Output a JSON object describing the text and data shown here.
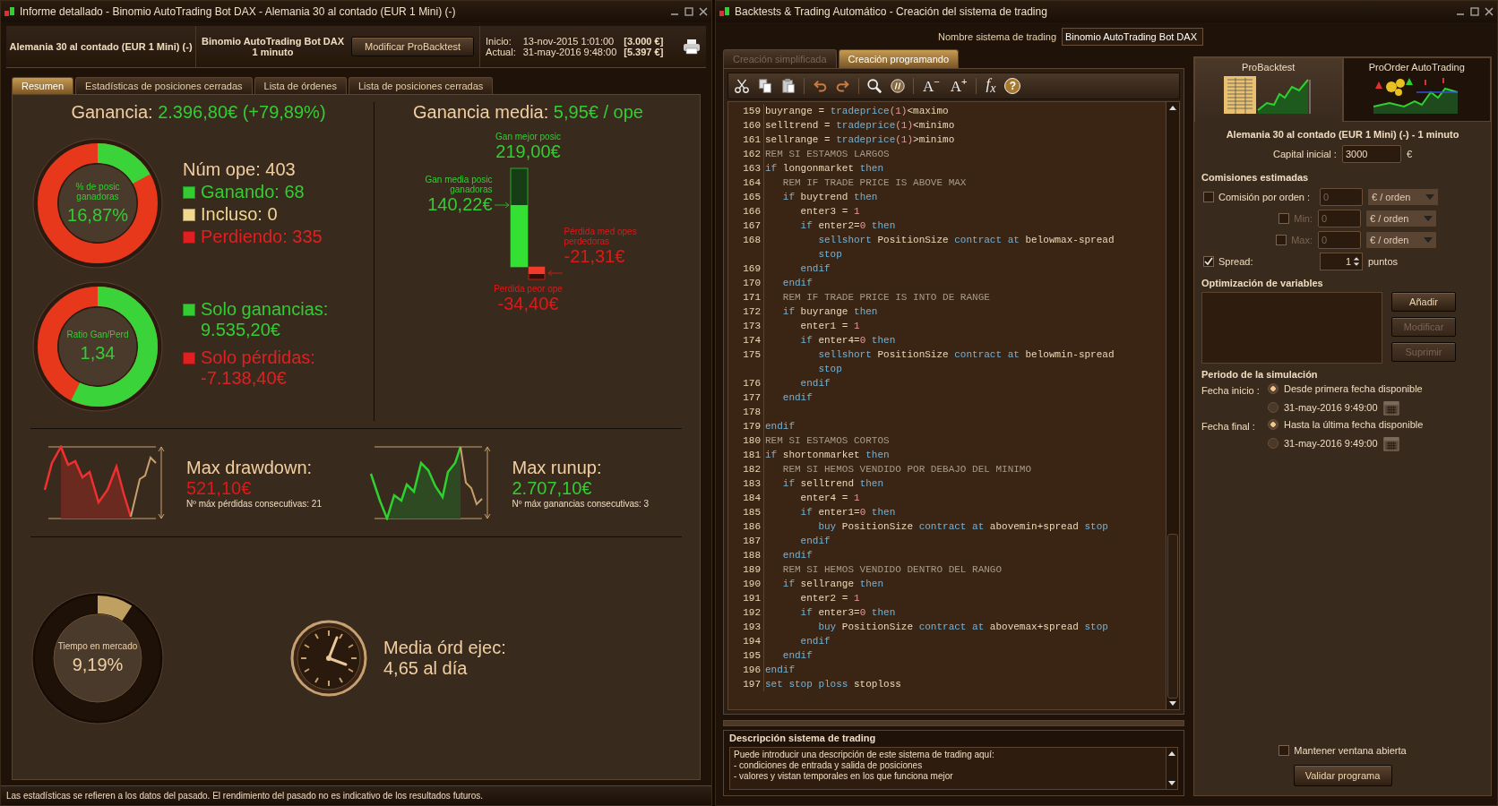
{
  "left_window": {
    "title": "Informe detallado - Binomio AutoTrading Bot DAX - Alemania 30 al contado (EUR 1 Mini) (-)",
    "header": {
      "instrument": "Alemania 30 al contado (EUR 1 Mini) (-)",
      "system_name": "Binomio AutoTrading Bot DAX",
      "timeframe": "1 minuto",
      "modify_button": "Modificar ProBacktest",
      "dates": [
        {
          "label": "Inicio:",
          "value": "13-nov-2015 1:01:00",
          "capital": "[3.000 €]"
        },
        {
          "label": "Actual:",
          "value": "31-may-2016 9:48:00",
          "capital": "[5.397 €]"
        }
      ]
    },
    "tabs": [
      {
        "label": "Resumen",
        "selected": true
      },
      {
        "label": "Estadísticas de posiciones cerradas",
        "selected": false
      },
      {
        "label": "Lista de órdenes",
        "selected": false
      },
      {
        "label": "Lista de posiciones cerradas",
        "selected": false
      }
    ],
    "summary": {
      "gain": {
        "label": "Ganancia:",
        "value": "2.396,80€ (+79,89%)"
      },
      "win_donut": {
        "label": "% de posic ganadoras",
        "value": "16,87%",
        "level": 0.1687
      },
      "num_ope": "Núm ope: 403",
      "counts": [
        {
          "text": "Ganando: 68",
          "color": "#33cc33"
        },
        {
          "text": "Incluso: 0",
          "color": "#f0d890"
        },
        {
          "text": "Perdiendo: 335",
          "color": "#e02020"
        }
      ],
      "ratio_donut": {
        "label": "Ratio Gan/Perd",
        "value": "1,34",
        "level": 0.572
      },
      "totals": [
        {
          "label": "Solo ganancias:",
          "value": "9.535,20€",
          "color": "#33cc33"
        },
        {
          "label": "Solo pérdidas:",
          "value": "-7.138,40€",
          "color": "#e02020"
        }
      ],
      "avg_gain": {
        "label": "Ganancia media:",
        "value": "5,95€ / ope"
      },
      "best": {
        "label": "Gan mejor posic",
        "value": "219,00€"
      },
      "avg_win": {
        "label": "Gan media posic ganadoras",
        "value": "140,22€"
      },
      "avg_loss": {
        "label": "Pérdida med opes perdedoras",
        "value": "-21,31€"
      },
      "worst": {
        "label": "Perdida peor ope",
        "value": "-34,40€"
      },
      "extremes": [
        {
          "kind": "drawdown",
          "label": "Max drawdown:",
          "value": "521,10€",
          "note": "Nº máx pérdidas consecutivas: 21"
        },
        {
          "kind": "runup",
          "label": "Max runup:",
          "value": "2.707,10€",
          "note": "Nº máx ganancias consecutivas: 3"
        }
      ],
      "market_time": {
        "label": "Tiempo en mercado",
        "value": "9,19%",
        "level": 0.0919
      },
      "orders": {
        "label": "Media órd ejec:",
        "value": "4,65 al día"
      }
    },
    "status_bar": "Las estadísticas se refieren a los datos del pasado. El rendimiento del pasado no es indicativo de los resultados futuros."
  },
  "right_window": {
    "title": "Backtests & Trading Automático - Creación del sistema de trading",
    "name_label": "Nombre sistema de trading",
    "name_value": "Binomio AutoTrading Bot DAX",
    "editor_tabs": [
      {
        "label": "Creación simplificada",
        "selected": false
      },
      {
        "label": "Creación programando",
        "selected": true
      }
    ],
    "toolbar": {
      "font_smaller": "A$^{−}$",
      "font_larger": "A$^{+}$",
      "formula": "f$_{x}$",
      "help": "?"
    },
    "code_lines": [
      {
        "n": "159",
        "parts": [
          {
            "text": "buyrange = ",
            "kind": "t"
          },
          {
            "text": "tradeprice",
            "kind": "k"
          },
          {
            "text": "(1)",
            "kind": "n"
          },
          {
            "text": "<maximo",
            "kind": "t"
          }
        ]
      },
      {
        "n": "160",
        "parts": [
          {
            "text": "selltrend = ",
            "kind": "t"
          },
          {
            "text": "tradeprice",
            "kind": "k"
          },
          {
            "text": "(1)",
            "kind": "n"
          },
          {
            "text": "<minimo",
            "kind": "t"
          }
        ]
      },
      {
        "n": "161",
        "parts": [
          {
            "text": "sellrange = ",
            "kind": "t"
          },
          {
            "text": "tradeprice",
            "kind": "k"
          },
          {
            "text": "(1)",
            "kind": "n"
          },
          {
            "text": ">minimo",
            "kind": "t"
          }
        ]
      },
      {
        "n": "162",
        "parts": [
          {
            "text": "REM SI ESTAMOS LARGOS",
            "kind": "r"
          }
        ]
      },
      {
        "n": "163",
        "parts": [
          {
            "text": "if",
            "kind": "k"
          },
          {
            "text": " longonmarket ",
            "kind": "t"
          },
          {
            "text": "then",
            "kind": "k"
          }
        ]
      },
      {
        "n": "164",
        "parts": [
          {
            "text": "   REM IF TRADE PRICE IS ABOVE MAX",
            "kind": "r"
          }
        ]
      },
      {
        "n": "165",
        "parts": [
          {
            "text": "   if",
            "kind": "k"
          },
          {
            "text": " buytrend ",
            "kind": "t"
          },
          {
            "text": "then",
            "kind": "k"
          }
        ]
      },
      {
        "n": "166",
        "parts": [
          {
            "text": "      enter3 = ",
            "kind": "t"
          },
          {
            "text": "1",
            "kind": "n"
          }
        ]
      },
      {
        "n": "167",
        "parts": [
          {
            "text": "      if",
            "kind": "k"
          },
          {
            "text": " enter2=",
            "kind": "t"
          },
          {
            "text": "0",
            "kind": "n"
          },
          {
            "text": " then",
            "kind": "k"
          }
        ]
      },
      {
        "n": "168",
        "parts": [
          {
            "text": "         sellshort",
            "kind": "k"
          },
          {
            "text": " PositionSize ",
            "kind": "t"
          },
          {
            "text": "contract at",
            "kind": "k"
          },
          {
            "text": " belowmax-spread",
            "kind": "t"
          }
        ]
      },
      {
        "parts": [
          {
            "text": "         stop",
            "kind": "k"
          }
        ]
      },
      {
        "n": "169",
        "parts": [
          {
            "text": "      endif",
            "kind": "k"
          }
        ]
      },
      {
        "n": "170",
        "parts": [
          {
            "text": "   endif",
            "kind": "k"
          }
        ]
      },
      {
        "n": "171",
        "parts": [
          {
            "text": "   REM IF TRADE PRICE IS INTO DE RANGE",
            "kind": "r"
          }
        ]
      },
      {
        "n": "172",
        "parts": [
          {
            "text": "   if",
            "kind": "k"
          },
          {
            "text": " buyrange ",
            "kind": "t"
          },
          {
            "text": "then",
            "kind": "k"
          }
        ]
      },
      {
        "n": "173",
        "parts": [
          {
            "text": "      enter1 = ",
            "kind": "t"
          },
          {
            "text": "1",
            "kind": "n"
          }
        ]
      },
      {
        "n": "174",
        "parts": [
          {
            "text": "      if",
            "kind": "k"
          },
          {
            "text": " enter4=",
            "kind": "t"
          },
          {
            "text": "0",
            "kind": "n"
          },
          {
            "text": " then",
            "kind": "k"
          }
        ]
      },
      {
        "n": "175",
        "parts": [
          {
            "text": "         sellshort",
            "kind": "k"
          },
          {
            "text": " PositionSize ",
            "kind": "t"
          },
          {
            "text": "contract at",
            "kind": "k"
          },
          {
            "text": " belowmin-spread",
            "kind": "t"
          }
        ]
      },
      {
        "parts": [
          {
            "text": "         stop",
            "kind": "k"
          }
        ]
      },
      {
        "n": "176",
        "parts": [
          {
            "text": "      endif",
            "kind": "k"
          }
        ]
      },
      {
        "n": "177",
        "parts": [
          {
            "text": "   endif",
            "kind": "k"
          }
        ]
      },
      {
        "n": "178"
      },
      {
        "n": "179",
        "parts": [
          {
            "text": "endif",
            "kind": "k"
          }
        ]
      },
      {
        "n": "180",
        "parts": [
          {
            "text": "REM SI ESTAMOS CORTOS",
            "kind": "r"
          }
        ]
      },
      {
        "n": "181",
        "parts": [
          {
            "text": "if",
            "kind": "k"
          },
          {
            "text": " shortonmarket ",
            "kind": "t"
          },
          {
            "text": "then",
            "kind": "k"
          }
        ]
      },
      {
        "n": "182",
        "parts": [
          {
            "text": "   REM SI HEMOS VENDIDO POR DEBAJO DEL MINIMO",
            "kind": "r"
          }
        ]
      },
      {
        "n": "183",
        "parts": [
          {
            "text": "   if",
            "kind": "k"
          },
          {
            "text": " selltrend ",
            "kind": "t"
          },
          {
            "text": "then",
            "kind": "k"
          }
        ]
      },
      {
        "n": "184",
        "parts": [
          {
            "text": "      enter4 = ",
            "kind": "t"
          },
          {
            "text": "1",
            "kind": "n"
          }
        ]
      },
      {
        "n": "185",
        "parts": [
          {
            "text": "      if",
            "kind": "k"
          },
          {
            "text": " enter1=",
            "kind": "t"
          },
          {
            "text": "0",
            "kind": "n"
          },
          {
            "text": " then",
            "kind": "k"
          }
        ]
      },
      {
        "n": "186",
        "parts": [
          {
            "text": "         buy",
            "kind": "k"
          },
          {
            "text": " PositionSize ",
            "kind": "t"
          },
          {
            "text": "contract at",
            "kind": "k"
          },
          {
            "text": " abovemin+spread ",
            "kind": "t"
          },
          {
            "text": "stop",
            "kind": "k"
          }
        ]
      },
      {
        "n": "187",
        "parts": [
          {
            "text": "      endif",
            "kind": "k"
          }
        ]
      },
      {
        "n": "188",
        "parts": [
          {
            "text": "   endif",
            "kind": "k"
          }
        ]
      },
      {
        "n": "189",
        "parts": [
          {
            "text": "   REM SI HEMOS VENDIDO DENTRO DEL RANGO",
            "kind": "r"
          }
        ]
      },
      {
        "n": "190",
        "parts": [
          {
            "text": "   if",
            "kind": "k"
          },
          {
            "text": " sellrange ",
            "kind": "t"
          },
          {
            "text": "then",
            "kind": "k"
          }
        ]
      },
      {
        "n": "191",
        "parts": [
          {
            "text": "      enter2 = ",
            "kind": "t"
          },
          {
            "text": "1",
            "kind": "n"
          }
        ]
      },
      {
        "n": "192",
        "parts": [
          {
            "text": "      if",
            "kind": "k"
          },
          {
            "text": " enter3=",
            "kind": "t"
          },
          {
            "text": "0",
            "kind": "n"
          },
          {
            "text": " then",
            "kind": "k"
          }
        ]
      },
      {
        "n": "193",
        "parts": [
          {
            "text": "         buy",
            "kind": "k"
          },
          {
            "text": " PositionSize ",
            "kind": "t"
          },
          {
            "text": "contract at",
            "kind": "k"
          },
          {
            "text": " abovemax+spread ",
            "kind": "t"
          },
          {
            "text": "stop",
            "kind": "k"
          }
        ]
      },
      {
        "n": "194",
        "parts": [
          {
            "text": "      endif",
            "kind": "k"
          }
        ]
      },
      {
        "n": "195",
        "parts": [
          {
            "text": "   endif",
            "kind": "k"
          }
        ]
      },
      {
        "n": "196",
        "parts": [
          {
            "text": "endif",
            "kind": "k"
          }
        ]
      },
      {
        "n": "197",
        "parts": [
          {
            "text": "set stop ploss",
            "kind": "k"
          },
          {
            "text": " stoploss",
            "kind": "t"
          }
        ]
      }
    ],
    "description": {
      "title": "Descripción sistema de trading",
      "lines": [
        "Puede introducir una descripción de este sistema de trading aquí:",
        "- condiciones de entrada y salida de posiciones",
        "- valores y vistan temporales  en los que funciona mejor"
      ]
    },
    "panel": {
      "tabs": [
        {
          "label": "ProBacktest",
          "selected": true
        },
        {
          "label": "ProOrder AutoTrading",
          "selected": false
        }
      ],
      "instrument": "Alemania 30 al contado (EUR 1 Mini) (-) - 1 minuto",
      "capital_label": "Capital inicial :",
      "capital_value": "3000",
      "currency": "€",
      "commissions_title": "Comisiones estimadas",
      "commissions": [
        {
          "kind": "main",
          "label": "Comisión por orden :",
          "checked": false,
          "value": "0",
          "unit": "€ / orden"
        },
        {
          "kind": "sub",
          "label": "Min:",
          "checked": false,
          "value": "0",
          "unit": "€ / orden"
        },
        {
          "kind": "sub",
          "label": "Max:",
          "checked": false,
          "value": "0",
          "unit": "€ / orden"
        }
      ],
      "spread": {
        "label": "Spread:",
        "checked": true,
        "value": "1",
        "unit": "puntos"
      },
      "optimization_title": "Optimización de variables",
      "buttons": [
        {
          "label": "Añadir",
          "disabled": false
        },
        {
          "label": "Modificar",
          "disabled": true
        },
        {
          "label": "Suprimir",
          "disabled": true
        }
      ],
      "period_title": "Periodo de la simulación",
      "period": [
        {
          "label": "Fecha inicio :",
          "options": [
            {
              "kind": "text",
              "text": "Desde primera fecha disponible",
              "selected": true
            },
            {
              "kind": "date",
              "text": "31-may-2016 9:49:00",
              "selected": false
            }
          ]
        },
        {
          "label": "Fecha final :",
          "options": [
            {
              "kind": "text",
              "text": "Hasta la última fecha disponible",
              "selected": true
            },
            {
              "kind": "date",
              "text": "31-may-2016 9:49:00",
              "selected": false
            }
          ]
        }
      ],
      "keep_open": {
        "label": "Mantener ventana abierta",
        "checked": false
      },
      "validate_button": "Validar programa"
    }
  }
}
